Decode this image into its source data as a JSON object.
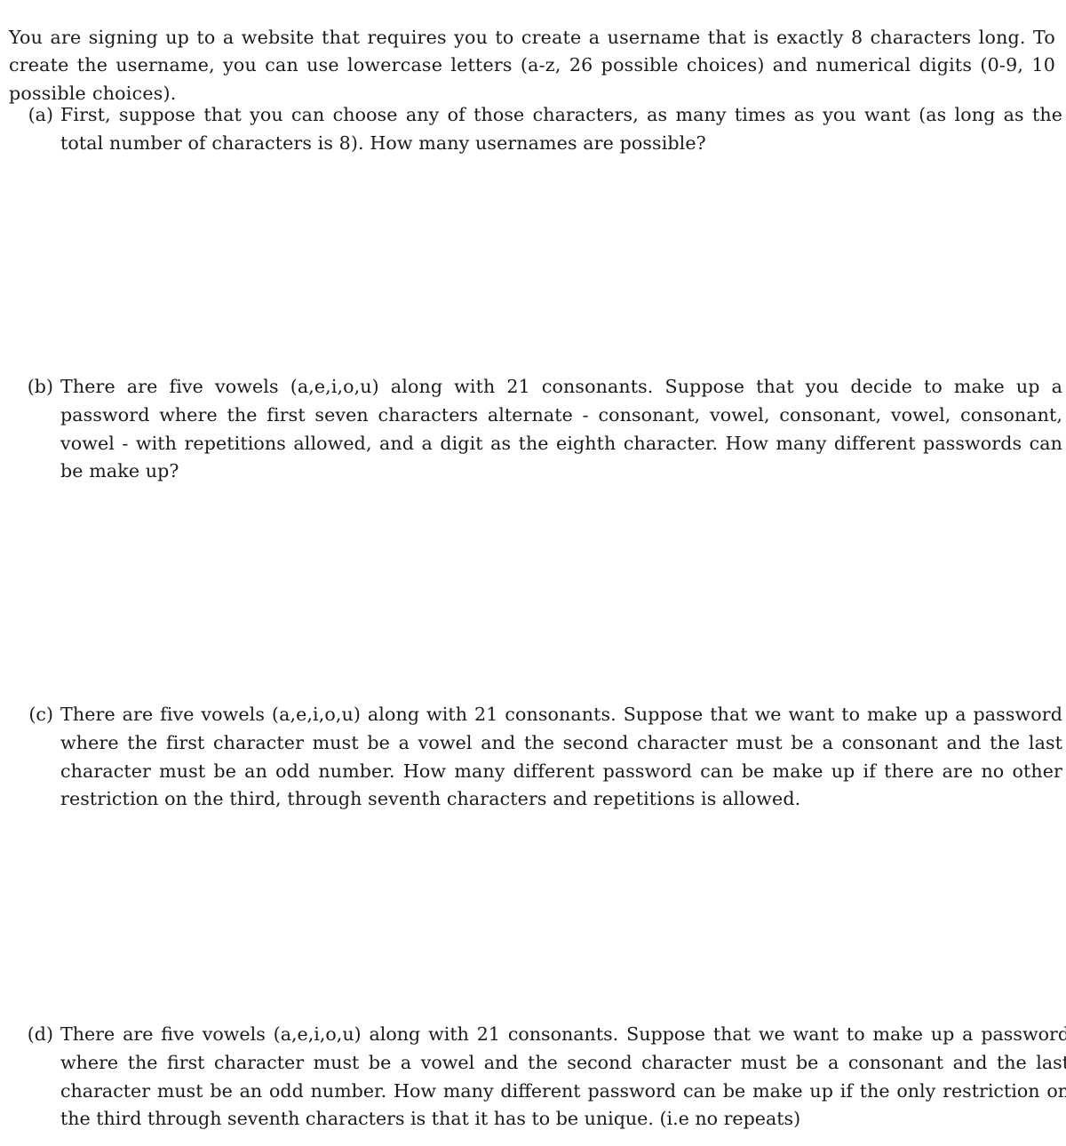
{
  "document": {
    "type": "math-worksheet",
    "background_color": "#ffffff",
    "text_color": "#1b1b1b"
  },
  "intro": {
    "text": "You are signing up to a website that requires you to create a username that is exactly 8 characters long. To create the username, you can use lowercase letters (a-z, 26 possible choices) and numerical digits (0-9, 10 possible choices)."
  },
  "problems": [
    {
      "label": "(a)",
      "text": "First, suppose that you can choose any of those characters, as many times as you want (as long as the total number of characters is 8). How many usernames are possible?"
    },
    {
      "label": "(b)",
      "text": "There are five vowels (a,e,i,o,u) along with 21 consonants. Suppose that you decide to make up a password where the first seven characters alternate - consonant, vowel, consonant, vowel, consonant, vowel - with repetitions allowed, and a digit as the eighth character. How many different passwords can be make up?"
    },
    {
      "label": "(c)",
      "text": "There are five vowels (a,e,i,o,u) along with 21 consonants. Suppose that we want to make up a password where the first character must be a vowel and the second character must be a consonant and the last character must be an odd number. How many different password can be make up if there are no other restriction on the third, through seventh characters and repetitions is allowed."
    },
    {
      "label": "(d)",
      "text": "There are five vowels (a,e,i,o,u) along with 21 consonants. Suppose that we want to make up a password where the first character must be a vowel and the second character must be a consonant and the last character must be an odd number. How many different password can be make up if the only restriction on the third through seventh characters is that it has to be unique. (i.e no repeats)"
    }
  ]
}
